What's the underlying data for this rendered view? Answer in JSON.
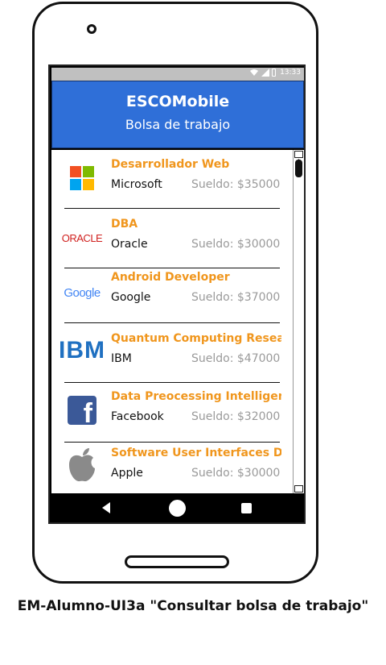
{
  "status_bar": {
    "time": "13:33"
  },
  "header": {
    "title": "ESCOMobile",
    "subtitle": "Bolsa de trabajo"
  },
  "jobs": [
    {
      "title": "Desarrollador Web",
      "company": "Microsoft",
      "salary": "Sueldo: $35000",
      "logo": "microsoft-logo"
    },
    {
      "title": "DBA",
      "company": "Oracle",
      "salary": "Sueldo: $30000",
      "logo": "oracle-logo",
      "logo_text": "ORACLE"
    },
    {
      "title": "Android Developer",
      "company": "Google",
      "salary": "Sueldo: $37000",
      "logo": "google-logo",
      "logo_text": "Google"
    },
    {
      "title": "Quantum Computing Resea",
      "company": "IBM",
      "salary": "Sueldo: $47000",
      "logo": "ibm-logo",
      "logo_text": "IBM"
    },
    {
      "title": "Data Preocessing Intelligence",
      "company": "Facebook",
      "salary": "Sueldo: $32000",
      "logo": "facebook-logo",
      "logo_text": "f"
    },
    {
      "title": "Software User Interfaces Des",
      "company": "Apple",
      "salary": "Sueldo: $30000",
      "logo": "apple-logo"
    }
  ],
  "caption": "EM-Alumno-UI3a \"Consultar bolsa de trabajo\"",
  "colors": {
    "header": "#2f6fd8",
    "job_title": "#f0961d",
    "salary": "#9a9a9a",
    "oracle": "#d0211f",
    "facebook": "#3b5998",
    "ibm": "#1f70c1"
  }
}
